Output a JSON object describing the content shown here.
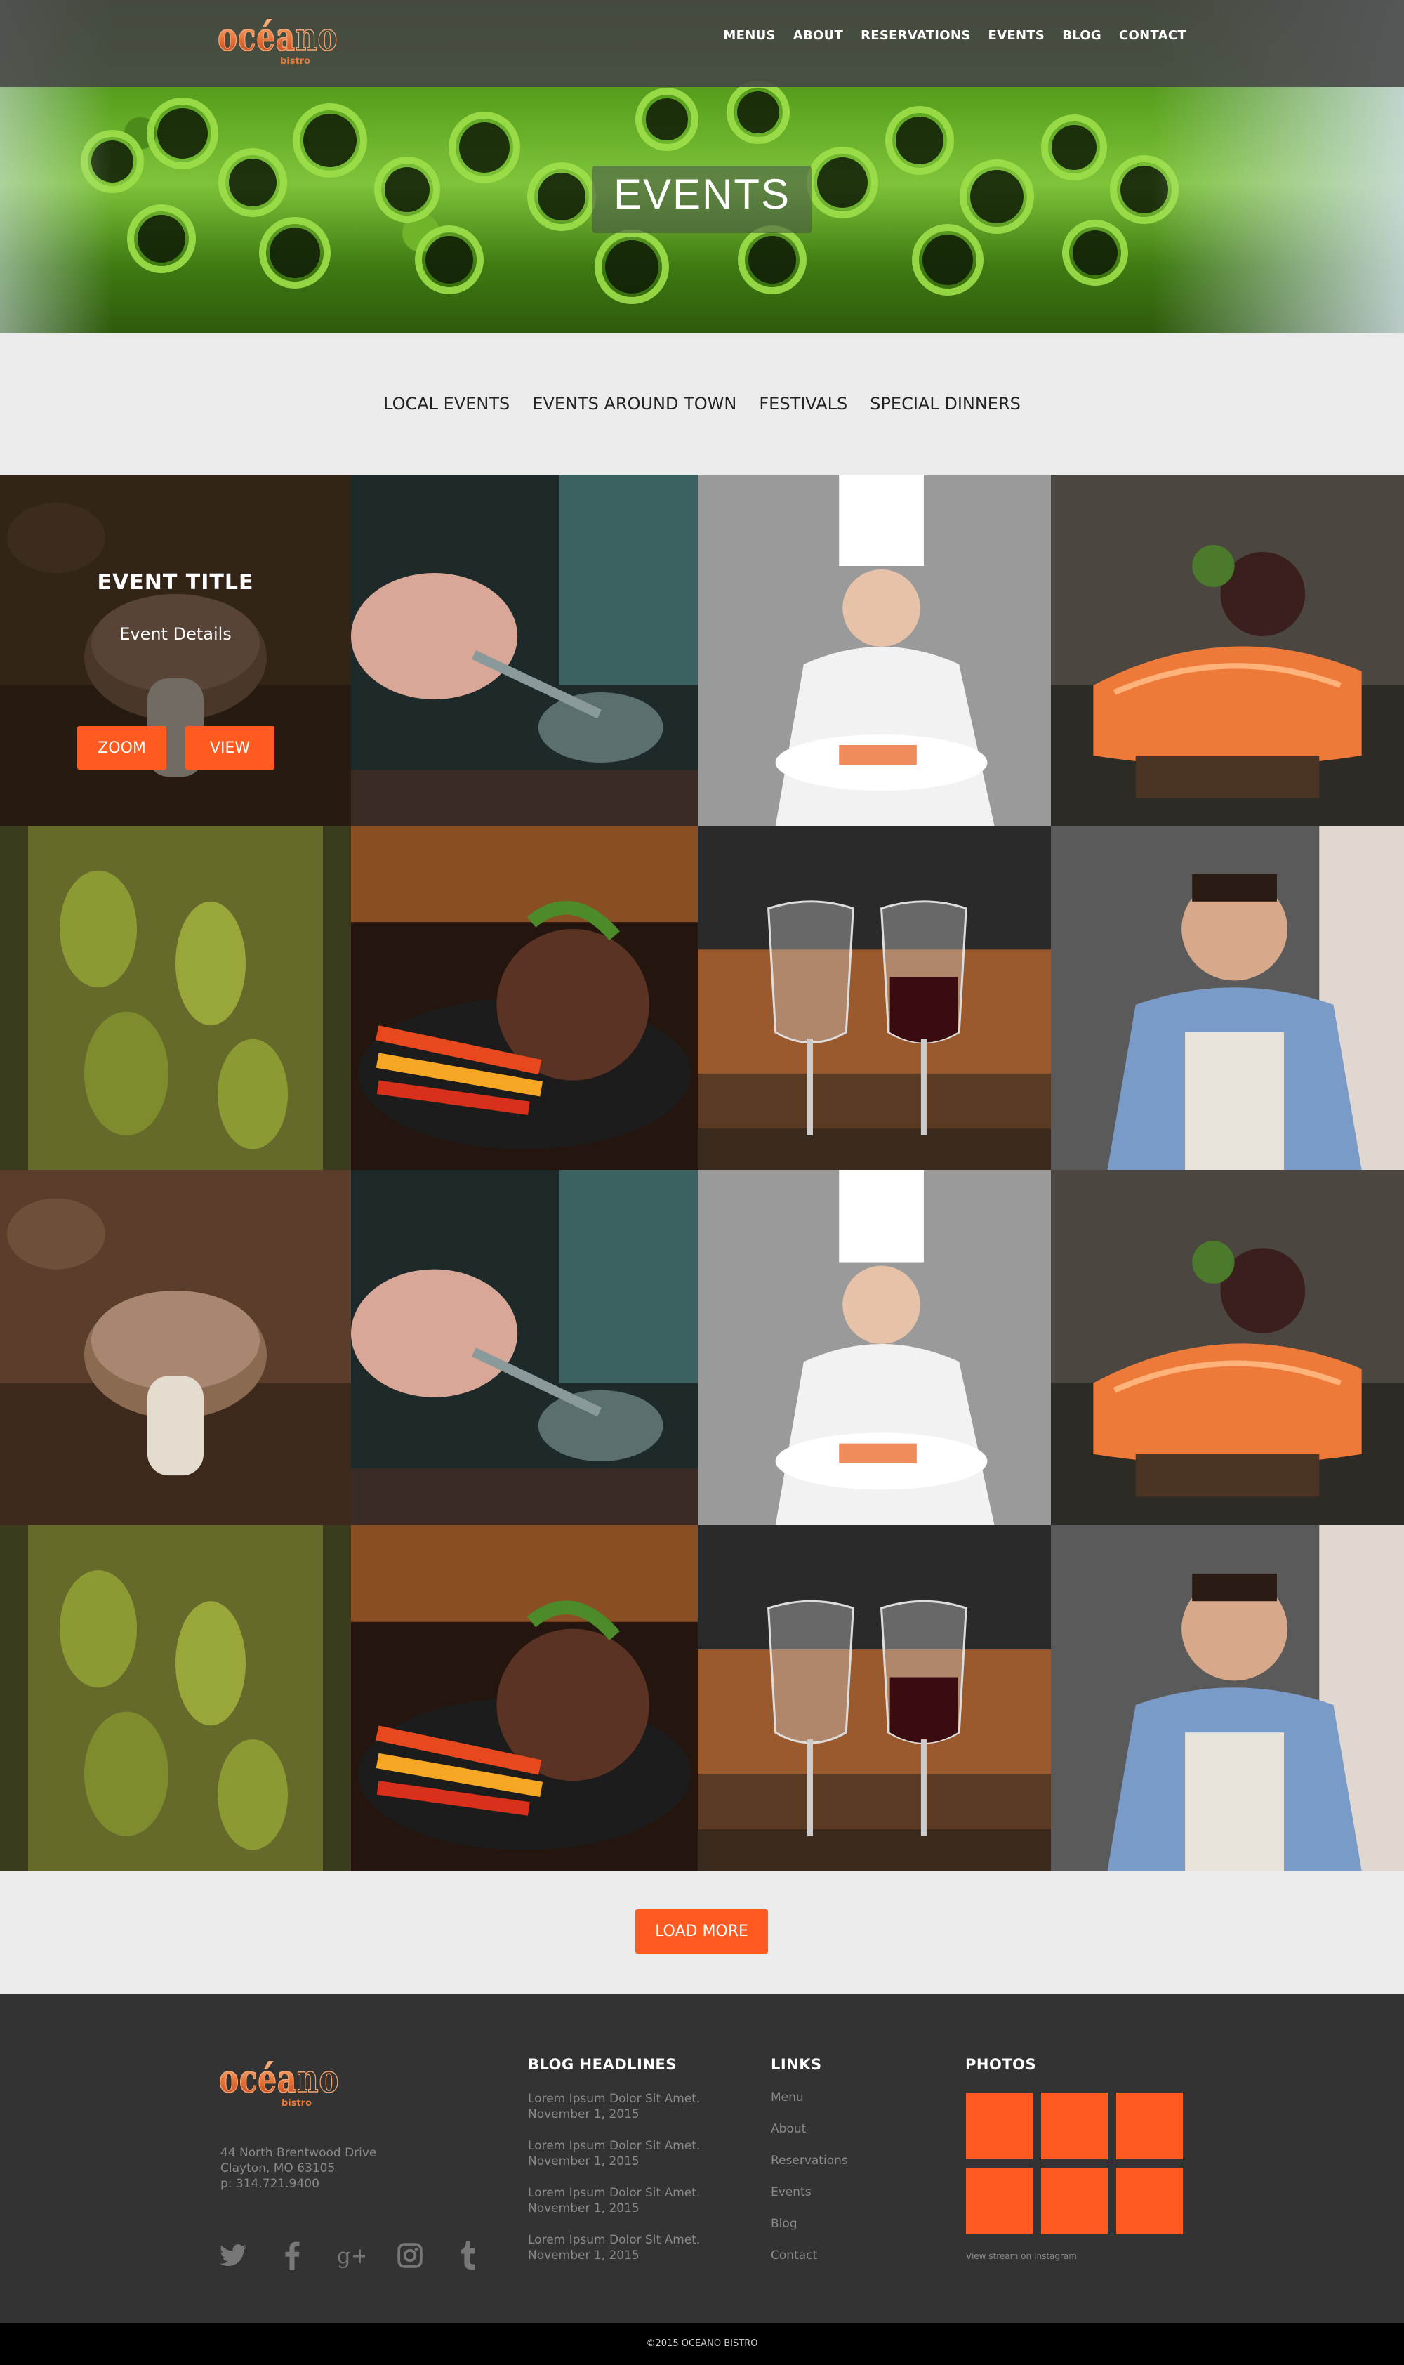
{
  "header": {
    "logo_text": "océano",
    "logo_sub": "bistro",
    "nav": [
      "MENUS",
      "ABOUT",
      "RESERVATIONS",
      "EVENTS",
      "BLOG",
      "CONTACT"
    ],
    "page_title": "EVENTS"
  },
  "categories": [
    "LOCAL EVENTS",
    "EVENTS AROUND TOWN",
    "FESTIVALS",
    "SPECIAL DINNERS"
  ],
  "gallery": {
    "featured": {
      "title": "EVENT TITLE",
      "details": "Event Details",
      "zoom_label": "ZOOM",
      "view_label": "VIEW"
    },
    "photos": [
      "mushroom",
      "chef-spoon",
      "chef-plating",
      "salmon",
      "pickles",
      "steak-vegetables",
      "wine-glasses",
      "smiling-chef",
      "mushroom",
      "chef-spoon",
      "chef-plating",
      "salmon",
      "pickles",
      "steak-vegetables",
      "wine-glasses",
      "smiling-chef"
    ]
  },
  "load_more_label": "LOAD MORE",
  "footer": {
    "logo_text": "océano",
    "logo_sub": "bistro",
    "address_line1": "44 North Brentwood Drive",
    "address_line2": "Clayton, MO 63105",
    "phone": "p: 314.721.9400",
    "social": [
      "twitter-icon",
      "facebook-icon",
      "google-plus-icon",
      "instagram-icon",
      "tumblr-icon"
    ],
    "blog_title": "BLOG HEADLINES",
    "blog_items": [
      {
        "headline": "Lorem Ipsum Dolor Sit Amet.",
        "date": "November 1, 2015"
      },
      {
        "headline": "Lorem Ipsum Dolor Sit Amet.",
        "date": "November 1, 2015"
      },
      {
        "headline": "Lorem Ipsum Dolor Sit Amet.",
        "date": "November 1, 2015"
      },
      {
        "headline": "Lorem Ipsum Dolor Sit Amet.",
        "date": "November 1, 2015"
      }
    ],
    "links_title": "LINKS",
    "links": [
      "Menu",
      "About",
      "Reservations",
      "Events",
      "Blog",
      "Contact"
    ],
    "photos_title": "PHOTOS",
    "instagram_label": "View stream on Instagram",
    "copyright": "©2015 OCEANO BISTRO"
  },
  "colors": {
    "accent": "#ff5a1f",
    "footer_bg": "#333333",
    "band_bg": "#ebebeb"
  }
}
